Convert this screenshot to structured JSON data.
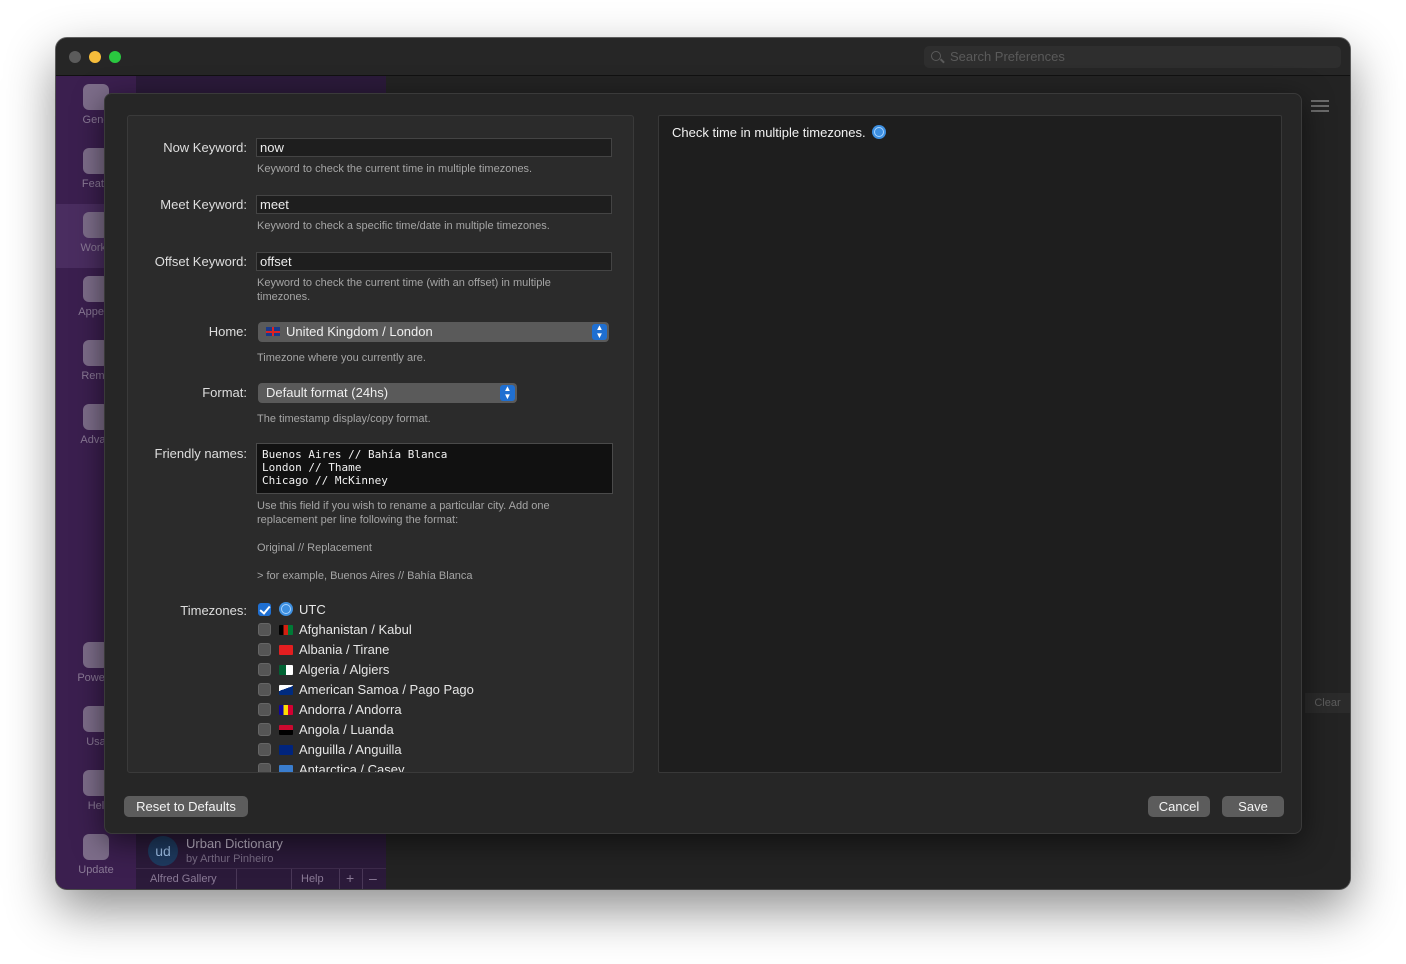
{
  "titlebar": {
    "search_placeholder": "Search Preferences"
  },
  "sidebar": {
    "items": [
      {
        "label": "Gene",
        "icon": "general-icon"
      },
      {
        "label": "Featu",
        "icon": "features-icon"
      },
      {
        "label": "Workfl",
        "icon": "workflows-icon"
      },
      {
        "label": "Appear",
        "icon": "appearance-icon"
      },
      {
        "label": "Remo",
        "icon": "remote-icon"
      },
      {
        "label": "Advan",
        "icon": "advanced-icon"
      },
      {
        "label": "Powerp",
        "icon": "powerpack-icon"
      },
      {
        "label": "Usa",
        "icon": "usage-icon"
      },
      {
        "label": "Hel",
        "icon": "help-icon"
      },
      {
        "label": "Update",
        "icon": "update-icon"
      }
    ]
  },
  "workflow_list": {
    "visible_item": {
      "title": "Urban Dictionary",
      "subtitle": "by Arthur Pinheiro",
      "logo": "ud"
    },
    "bottom": {
      "gallery": "Alfred Gallery",
      "help": "Help",
      "plus": "+",
      "minus": "–"
    }
  },
  "right_pane": {
    "clear_label": "Clear"
  },
  "form": {
    "now_keyword": {
      "label": "Now Keyword:",
      "value": "now",
      "help": "Keyword to check the current time in multiple timezones."
    },
    "meet_keyword": {
      "label": "Meet Keyword:",
      "value": "meet",
      "help": "Keyword to check a specific time/date in multiple timezones."
    },
    "offset_keyword": {
      "label": "Offset Keyword:",
      "value": "offset",
      "help": "Keyword to check the current time (with an offset) in multiple timezones."
    },
    "home": {
      "label": "Home:",
      "value": "United Kingdom / London",
      "help": "Timezone where you currently are."
    },
    "format": {
      "label": "Format:",
      "value": "Default format (24hs)",
      "help": "The timestamp display/copy format."
    },
    "friendly_names": {
      "label": "Friendly names:",
      "value": "Buenos Aires // Bahía Blanca\nLondon // Thame\nChicago // McKinney",
      "help1": "Use this field if you wish to rename a particular city. Add one replacement per line following the format:",
      "help2": "Original // Replacement",
      "help3": "> for example, Buenos Aires // Bahía Blanca"
    },
    "timezones": {
      "label": "Timezones:",
      "items": [
        {
          "name": "UTC",
          "checked": true,
          "flag": "globe-icon",
          "colors": [
            "#3d8fe0"
          ]
        },
        {
          "name": "Afghanistan / Kabul",
          "checked": false,
          "flag": "afghanistan-flag-icon",
          "colors": [
            "#000000",
            "#d32011",
            "#007a36"
          ]
        },
        {
          "name": "Albania / Tirane",
          "checked": false,
          "flag": "albania-flag-icon",
          "colors": [
            "#e41e20",
            "#e41e20"
          ]
        },
        {
          "name": "Algeria / Algiers",
          "checked": false,
          "flag": "algeria-flag-icon",
          "colors": [
            "#006233",
            "#ffffff"
          ]
        },
        {
          "name": "American Samoa / Pago Pago",
          "checked": false,
          "flag": "american-samoa-flag-icon",
          "colors": [
            "#002b7f",
            "#ffffff"
          ]
        },
        {
          "name": "Andorra / Andorra",
          "checked": false,
          "flag": "andorra-flag-icon",
          "colors": [
            "#10069f",
            "#fedd00",
            "#d50032"
          ]
        },
        {
          "name": "Angola / Luanda",
          "checked": false,
          "flag": "angola-flag-icon",
          "colors": [
            "#cc092f",
            "#000000"
          ]
        },
        {
          "name": "Anguilla / Anguilla",
          "checked": false,
          "flag": "anguilla-flag-icon",
          "colors": [
            "#00247d",
            "#cf142b"
          ]
        },
        {
          "name": "Antarctica / Casey",
          "checked": false,
          "flag": "antarctica-flag-icon",
          "colors": [
            "#3a7dce",
            "#ffffff"
          ]
        }
      ]
    }
  },
  "preview": {
    "text": "Check time in multiple timezones."
  },
  "buttons": {
    "reset": "Reset to Defaults",
    "cancel": "Cancel",
    "save": "Save"
  }
}
